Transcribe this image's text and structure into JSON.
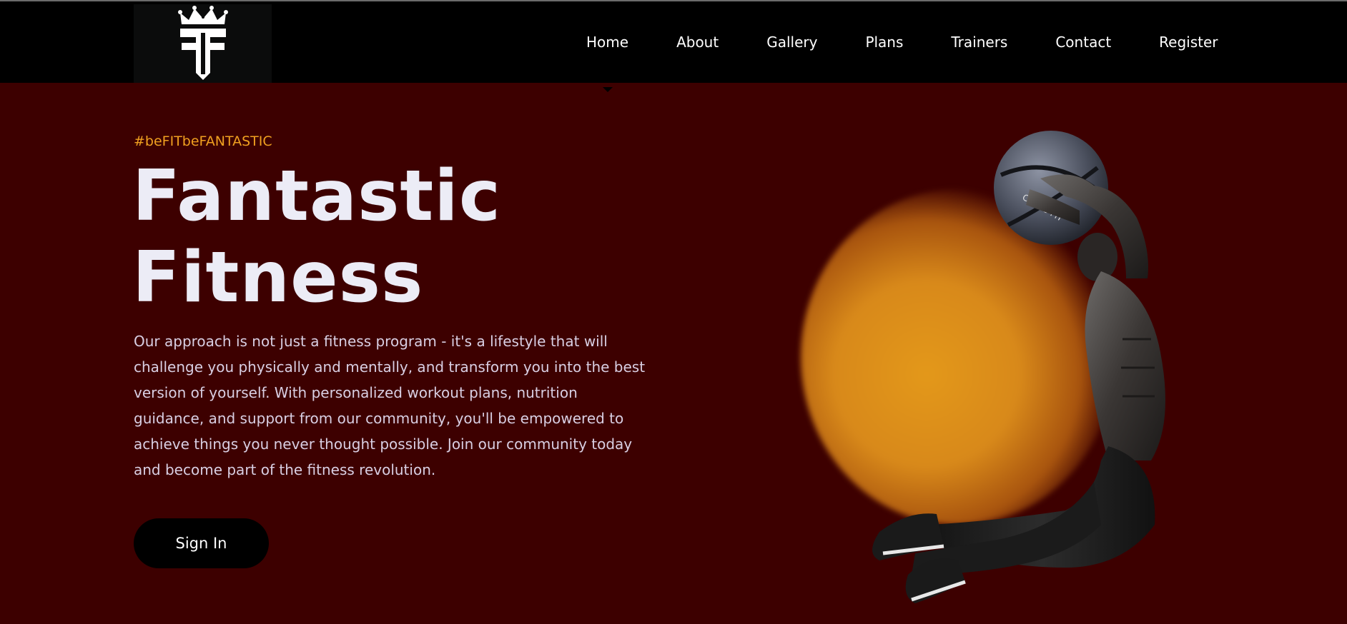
{
  "header": {
    "logo_icon": "crown-ff-monogram-logo",
    "nav": [
      {
        "label": "Home",
        "active": true
      },
      {
        "label": "About"
      },
      {
        "label": "Gallery"
      },
      {
        "label": "Plans"
      },
      {
        "label": "Trainers"
      },
      {
        "label": "Contact"
      },
      {
        "label": "Register"
      }
    ]
  },
  "hero": {
    "tagline": "#beFITbeFANTASTIC",
    "title_line1": "Fantastic",
    "title_line2": "Fitness",
    "description": "Our approach is not just a fitness program - it's a lifestyle that will challenge you physically and mentally, and transform you into the best version of yourself. With personalized workout plans, nutrition guidance, and support from our community, you'll be empowered to achieve things you never thought possible. Join our community today and become part of the fitness revolution.",
    "signin_label": "Sign In",
    "image": "athlete-with-medicine-ball",
    "ball_text": "CROSS FIT"
  },
  "colors": {
    "background": "#3d0000",
    "navbar": "#000000",
    "accent": "#f0a020",
    "title": "#ececf6",
    "glow": "#e3981a"
  }
}
